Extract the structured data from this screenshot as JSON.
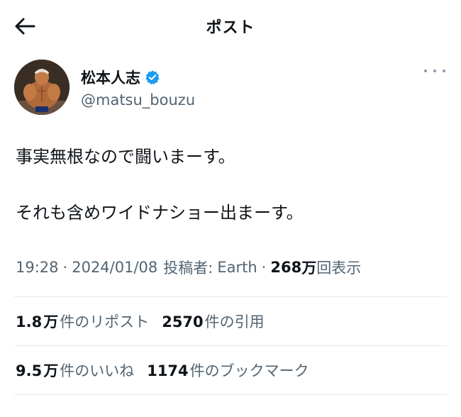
{
  "header": {
    "title": "ポスト",
    "back_icon": "arrow-left-icon"
  },
  "author": {
    "display_name": "松本人志",
    "handle": "@matsu_bouzu",
    "verified_color": "#1d9bf0"
  },
  "tweet": {
    "line1": "事実無根なので闘いまーす。",
    "line2": "それも含めワイドナショー出まーす。"
  },
  "meta": {
    "time": "19:28",
    "separator": "·",
    "date": "2024/01/08",
    "posted_by_label": "投稿者:",
    "posted_by": "Earth",
    "views_value": "268",
    "views_unit": "万",
    "views_label": "回表示"
  },
  "stats": {
    "reposts_value": "1.8",
    "reposts_unit": "万",
    "reposts_label": "件のリポスト",
    "quotes_value": "2570",
    "quotes_label": " 件の引用",
    "likes_value": "9.5",
    "likes_unit": "万",
    "likes_label": "件のいいね",
    "bookmarks_value": "1174",
    "bookmarks_label": " 件のブックマーク"
  }
}
